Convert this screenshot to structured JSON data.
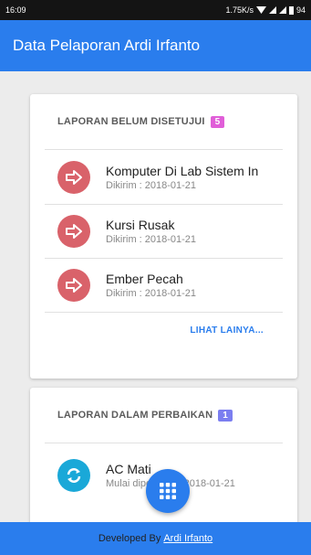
{
  "status_bar": {
    "time": "16:09",
    "network_speed": "1.75K/s",
    "battery": "94"
  },
  "app_bar": {
    "title": "Data Pelaporan Ardi Irfanto",
    "color": "#2a7ded"
  },
  "pending_section": {
    "title": "LAPORAN BELUM DISETUJUI",
    "count": "5",
    "badge_color": "#e05ed8",
    "items": [
      {
        "title": "Komputer Di Lab Sistem In",
        "subtitle": "Dikirim : 2018-01-21",
        "icon": "arrow-right-icon"
      },
      {
        "title": "Kursi Rusak",
        "subtitle": "Dikirim : 2018-01-21",
        "icon": "arrow-right-icon"
      },
      {
        "title": "Ember Pecah",
        "subtitle": "Dikirim : 2018-01-21",
        "icon": "arrow-right-icon"
      }
    ],
    "icon_color": "#d9626a",
    "more_label": "LIHAT LAINYA..."
  },
  "repair_section": {
    "title": "LAPORAN DALAM PERBAIKAN",
    "count": "1",
    "badge_color": "#7b7ef0",
    "items": [
      {
        "title": "AC Mati",
        "subtitle": "Mulai diperbaiki : 2018-01-21",
        "icon": "sync-icon"
      }
    ],
    "icon_color": "#1aa8d8"
  },
  "fab": {
    "icon": "grid-menu-icon"
  },
  "footer": {
    "text": "Developed By",
    "link": "Ardi Irfanto"
  }
}
